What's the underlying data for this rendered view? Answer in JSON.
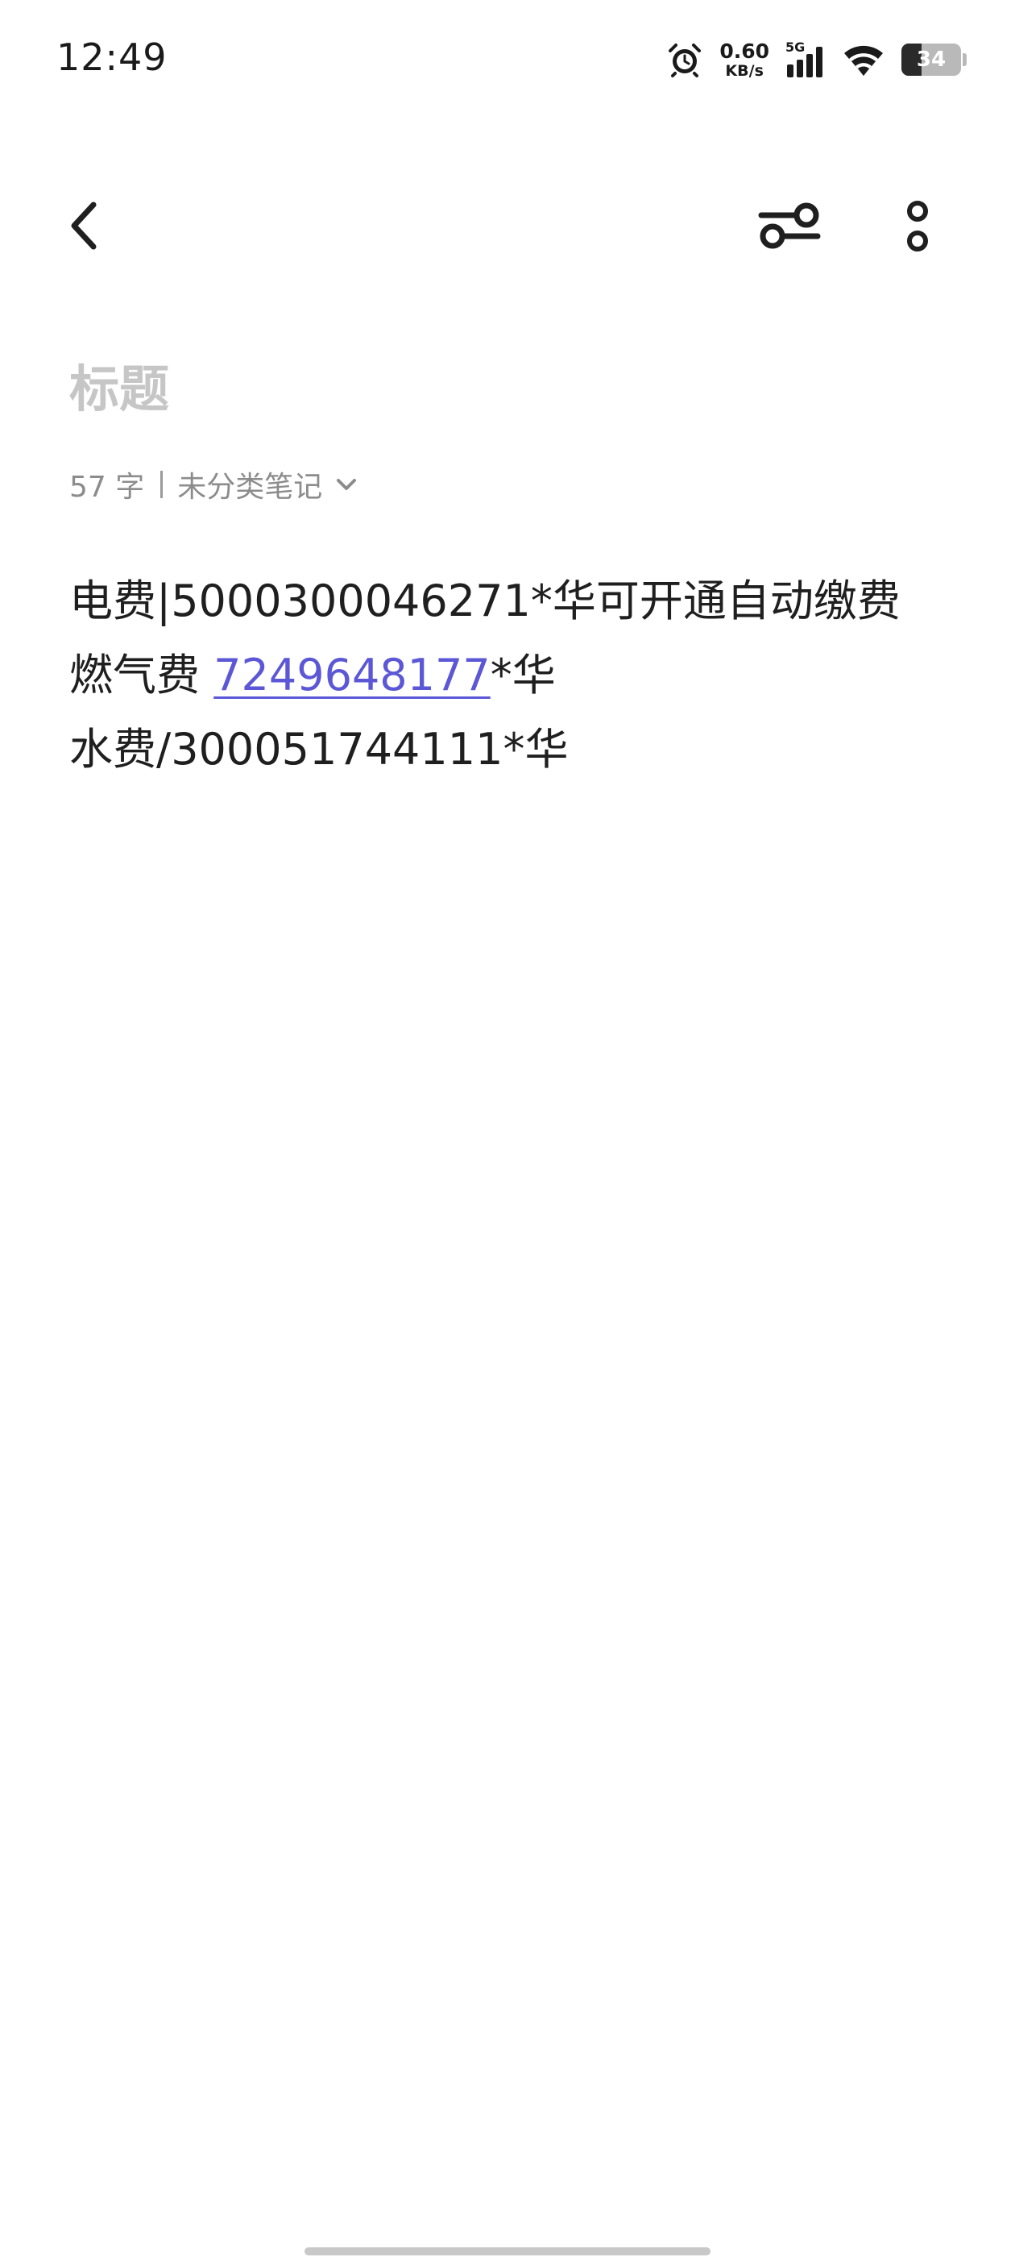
{
  "status_bar": {
    "time": "12:49",
    "alarm_icon": "alarm-clock-icon",
    "net_speed_value": "0.60",
    "net_speed_unit": "KB/s",
    "network_type": "5G",
    "signal_icon": "cellular-signal-icon",
    "wifi_icon": "wifi-icon",
    "battery_level": "34",
    "battery_fraction": 0.34
  },
  "toolbar": {
    "back_icon": "chevron-left-icon",
    "format_icon": "sliders-icon",
    "more_icon": "more-vertical-icon"
  },
  "note": {
    "title_value": "",
    "title_placeholder": "标题",
    "char_count": "57 字",
    "category": "未分类笔记",
    "category_icon": "chevron-down-icon",
    "lines": [
      {
        "text": "电费|5000300046271*华可开通自动缴费"
      },
      {
        "prefix": "燃气费 ",
        "link": "7249648177",
        "suffix": "*华"
      },
      {
        "text": "水费/300051744111*华"
      }
    ]
  },
  "colors": {
    "link": "#5b57d6",
    "placeholder": "#c6c6c6",
    "meta_text": "#8c8c8c",
    "body_text": "#1f1f1f",
    "background": "#ffffff"
  }
}
